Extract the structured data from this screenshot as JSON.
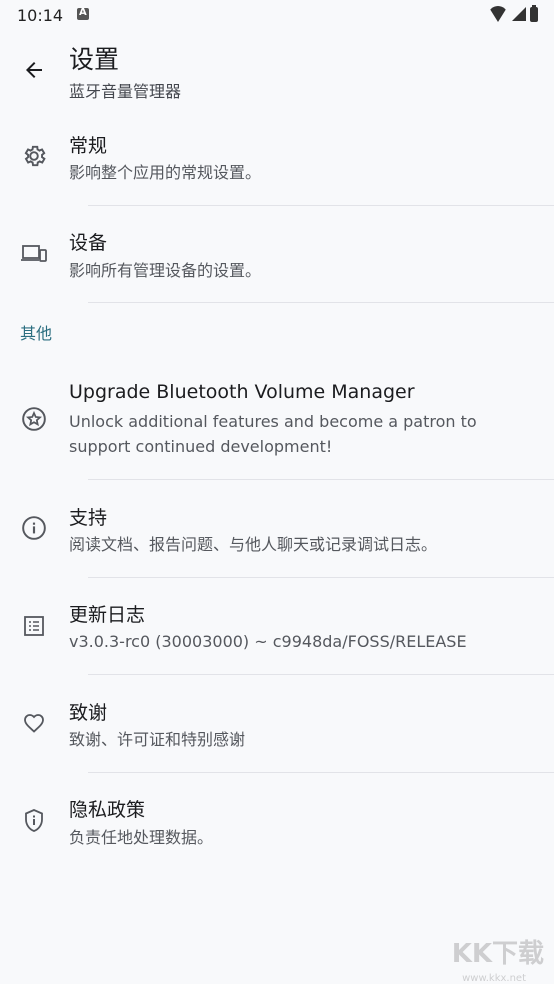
{
  "status_bar": {
    "time": "10:14"
  },
  "app_bar": {
    "title": "设置",
    "subtitle": "蓝牙音量管理器"
  },
  "items_top": [
    {
      "label": "常规",
      "desc": "影响整个应用的常规设置。",
      "icon": "gear-icon"
    },
    {
      "label": "设备",
      "desc": "影响所有管理设备的设置。",
      "icon": "devices-icon"
    }
  ],
  "section_other": "其他",
  "items_other": [
    {
      "label": "Upgrade Bluetooth Volume Manager",
      "desc": "Unlock additional features and become a patron to support continued development!",
      "icon": "star-badge-icon"
    },
    {
      "label": "支持",
      "desc": "阅读文档、报告问题、与他人聊天或记录调试日志。",
      "icon": "info-icon"
    },
    {
      "label": "更新日志",
      "desc": "v3.0.3-rc0 (30003000) ~ c9948da/FOSS/RELEASE",
      "icon": "changelog-icon"
    },
    {
      "label": "致谢",
      "desc": "致谢、许可证和特别感谢",
      "icon": "heart-icon"
    },
    {
      "label": "隐私政策",
      "desc": "负责任地处理数据。",
      "icon": "shield-icon"
    }
  ],
  "watermark": {
    "text": "KK下载",
    "url": "www.kkx.net"
  }
}
